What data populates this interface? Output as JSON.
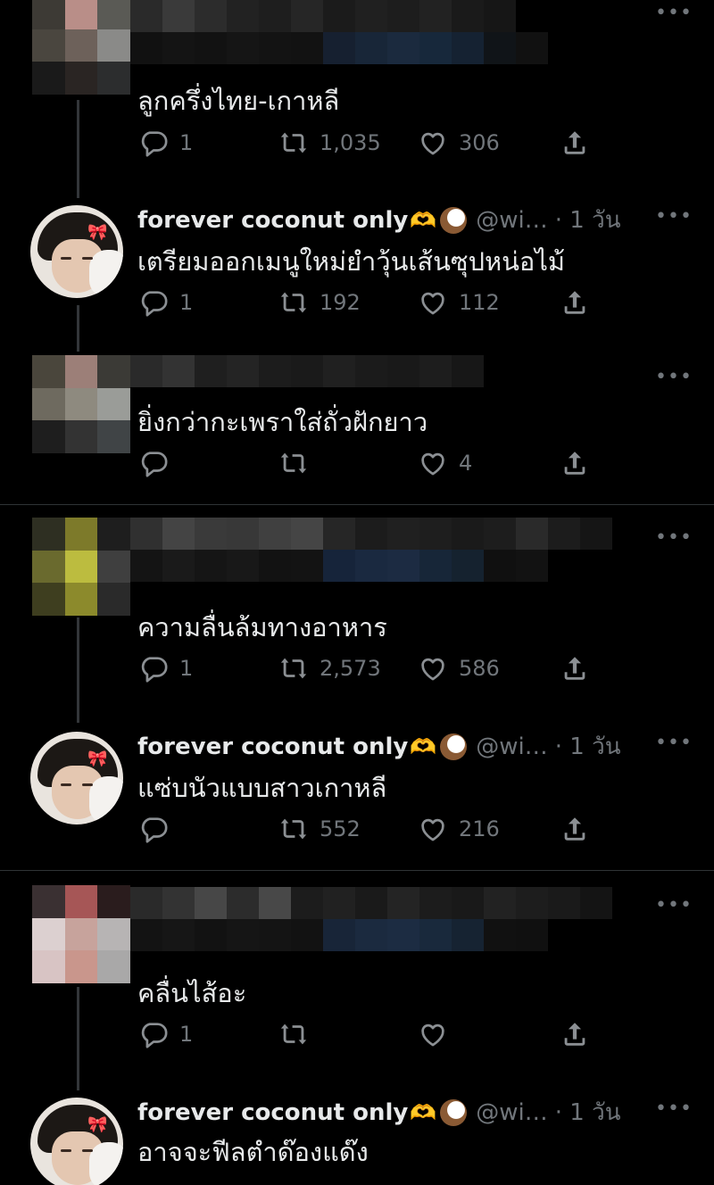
{
  "icons": {
    "reply": "reply-icon",
    "retweet": "retweet-icon",
    "like": "heart-icon",
    "share": "share-icon",
    "more": "more-icon"
  },
  "colors": {
    "background": "#000000",
    "text": "#e7e9ea",
    "muted": "#71767b",
    "separator": "#2f3336"
  },
  "more_label": "•••",
  "tweets": [
    {
      "author_redacted": true,
      "text": "ลูกครึ่งไทย-เกาหลี",
      "replies": "1",
      "retweets": "1,035",
      "likes": "306"
    },
    {
      "author": "forever coconut only",
      "emoji": "🫶",
      "handle": "@wi…",
      "time": "· 1 วัน",
      "text": "เตรียมออกเมนูใหม่ยำวุ้นเส้นซุปหน่อไม้",
      "replies": "1",
      "retweets": "192",
      "likes": "112"
    },
    {
      "author_redacted": true,
      "text": "ยิ่งกว่ากะเพราใส่ถั่วฝักยาว",
      "replies": "",
      "retweets": "",
      "likes": "4"
    },
    {
      "author_redacted": true,
      "text": "ความลื่นล้มทางอาหาร",
      "replies": "1",
      "retweets": "2,573",
      "likes": "586"
    },
    {
      "author": "forever coconut only",
      "emoji": "🫶",
      "handle": "@wi…",
      "time": "· 1 วัน",
      "text": "แซ่บนัวแบบสาวเกาหลี",
      "replies": "",
      "retweets": "552",
      "likes": "216"
    },
    {
      "author_redacted": true,
      "text": "คลื่นไส้อะ",
      "replies": "1",
      "retweets": "",
      "likes": ""
    },
    {
      "author": "forever coconut only",
      "emoji": "🫶",
      "handle": "@wi…",
      "time": "· 1 วัน",
      "text": "อาจจะฟีลตำด๊องแด๊ง"
    }
  ]
}
